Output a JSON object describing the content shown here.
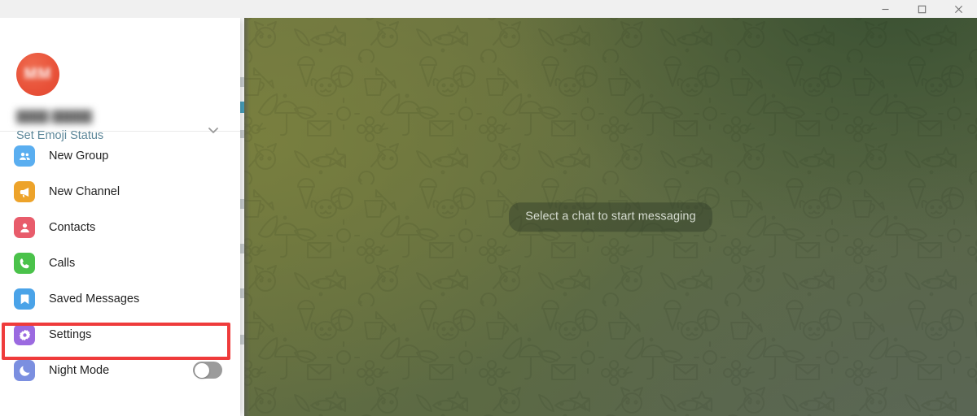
{
  "window": {
    "controls": [
      {
        "name": "minimize",
        "glyph": "minimize-icon"
      },
      {
        "name": "maximize",
        "glyph": "maximize-icon"
      },
      {
        "name": "close",
        "glyph": "close-icon"
      }
    ]
  },
  "account": {
    "avatar_initials": "MM",
    "avatar_color": "#e85138",
    "name": "",
    "name_blurred": true,
    "emoji_status_label": "Set Emoji Status",
    "emoji_status_color": "#5d8799",
    "expand_icon": "chevron-down-icon"
  },
  "menu": {
    "items": [
      {
        "label": "New Group",
        "icon": "new-group-icon",
        "color": "#5aaef0"
      },
      {
        "label": "New Channel",
        "icon": "new-channel-icon",
        "color": "#eda32a"
      },
      {
        "label": "Contacts",
        "icon": "contacts-icon",
        "color": "#e85c6b"
      },
      {
        "label": "Calls",
        "icon": "calls-icon",
        "color": "#4ac24a"
      },
      {
        "label": "Saved Messages",
        "icon": "saved-messages-icon",
        "color": "#4aa3e8"
      },
      {
        "label": "Settings",
        "icon": "settings-gear-icon",
        "color": "#9b6ae0"
      },
      {
        "label": "Night Mode",
        "icon": "night-mode-icon",
        "color": "#7b8fe0"
      }
    ],
    "night_mode_toggle": {
      "state": "off",
      "track_color": "#9b9b9b",
      "knob_color": "#ffffff"
    }
  },
  "highlight": {
    "target_label": "Settings",
    "color": "#ef3b3b"
  },
  "chat": {
    "placeholder_text": "Select a chat to start messaging",
    "background_colors": [
      "#6f7643",
      "#5c6a44",
      "#3e5438",
      "#566248"
    ],
    "pill_background": "rgba(42,56,38,0.40)",
    "pill_text_color": "#d5dbd0"
  }
}
